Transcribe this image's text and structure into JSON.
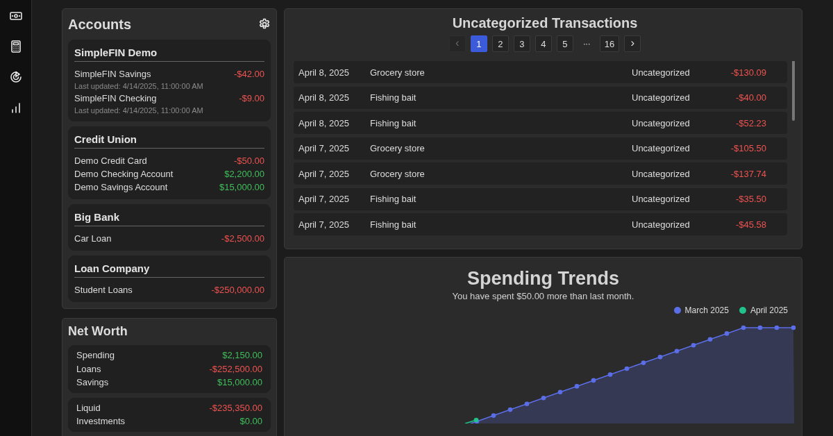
{
  "sidebar": {
    "items": [
      {
        "kind": "money",
        "selected": false
      },
      {
        "kind": "calculator",
        "selected": false
      },
      {
        "kind": "target",
        "selected": false
      },
      {
        "kind": "bars",
        "selected": false
      }
    ]
  },
  "accounts": {
    "title": "Accounts",
    "institutions": [
      {
        "name": "SimpleFIN Demo",
        "accounts": [
          {
            "name": "SimpleFIN Savings",
            "balance": "-$42.00",
            "negative": true,
            "updated": "Last updated: 4/14/2025, 11:00:00 AM"
          },
          {
            "name": "SimpleFIN Checking",
            "balance": "-$9.00",
            "negative": true,
            "updated": "Last updated: 4/14/2025, 11:00:00 AM"
          }
        ]
      },
      {
        "name": "Credit Union",
        "accounts": [
          {
            "name": "Demo Credit Card",
            "balance": "-$50.00",
            "negative": true
          },
          {
            "name": "Demo Checking Account",
            "balance": "$2,200.00",
            "negative": false
          },
          {
            "name": "Demo Savings Account",
            "balance": "$15,000.00",
            "negative": false
          }
        ]
      },
      {
        "name": "Big Bank",
        "accounts": [
          {
            "name": "Car Loan",
            "balance": "-$2,500.00",
            "negative": true
          }
        ]
      },
      {
        "name": "Loan Company",
        "accounts": [
          {
            "name": "Student Loans",
            "balance": "-$250,000.00",
            "negative": true
          }
        ]
      }
    ]
  },
  "net_worth": {
    "title": "Net Worth",
    "groups": [
      [
        {
          "label": "Spending",
          "amount": "$2,150.00",
          "negative": false
        },
        {
          "label": "Loans",
          "amount": "-$252,500.00",
          "negative": true
        },
        {
          "label": "Savings",
          "amount": "$15,000.00",
          "negative": false
        }
      ],
      [
        {
          "label": "Liquid",
          "amount": "-$235,350.00",
          "negative": true
        },
        {
          "label": "Investments",
          "amount": "$0.00",
          "negative": false
        }
      ]
    ]
  },
  "transactions": {
    "title": "Uncategorized Transactions",
    "previous": {
      "label": "‹",
      "disabled": true
    },
    "pages": [
      {
        "kind": "page",
        "label": "1",
        "selected": true
      },
      {
        "kind": "page",
        "label": "2",
        "selected": false
      },
      {
        "kind": "page",
        "label": "3",
        "selected": false
      },
      {
        "kind": "page",
        "label": "4",
        "selected": false
      },
      {
        "kind": "page",
        "label": "5",
        "selected": false
      },
      {
        "kind": "ellipsis",
        "label": "···",
        "selected": false
      },
      {
        "kind": "page",
        "label": "16",
        "selected": false
      }
    ],
    "next": {
      "label": "›",
      "disabled": false
    },
    "rows": [
      {
        "date": "April 8, 2025",
        "description": "Grocery store",
        "category": "Uncategorized",
        "amount": "-$130.09",
        "negative": true
      },
      {
        "date": "April 8, 2025",
        "description": "Fishing bait",
        "category": "Uncategorized",
        "amount": "-$40.00",
        "negative": true
      },
      {
        "date": "April 8, 2025",
        "description": "Fishing bait",
        "category": "Uncategorized",
        "amount": "-$52.23",
        "negative": true
      },
      {
        "date": "April 7, 2025",
        "description": "Grocery store",
        "category": "Uncategorized",
        "amount": "-$105.50",
        "negative": true
      },
      {
        "date": "April 7, 2025",
        "description": "Grocery store",
        "category": "Uncategorized",
        "amount": "-$137.74",
        "negative": true
      },
      {
        "date": "April 7, 2025",
        "description": "Fishing bait",
        "category": "Uncategorized",
        "amount": "-$35.50",
        "negative": true
      },
      {
        "date": "April 7, 2025",
        "description": "Fishing bait",
        "category": "Uncategorized",
        "amount": "-$45.58",
        "negative": true
      }
    ]
  },
  "spending_trends": {
    "title": "Spending Trends",
    "subtitle": "You have spent $50.00 more than last month.",
    "legend": [
      {
        "label": "March 2025",
        "color": "#5b6ee8"
      },
      {
        "label": "April 2025",
        "color": "#20c28a"
      }
    ]
  }
}
